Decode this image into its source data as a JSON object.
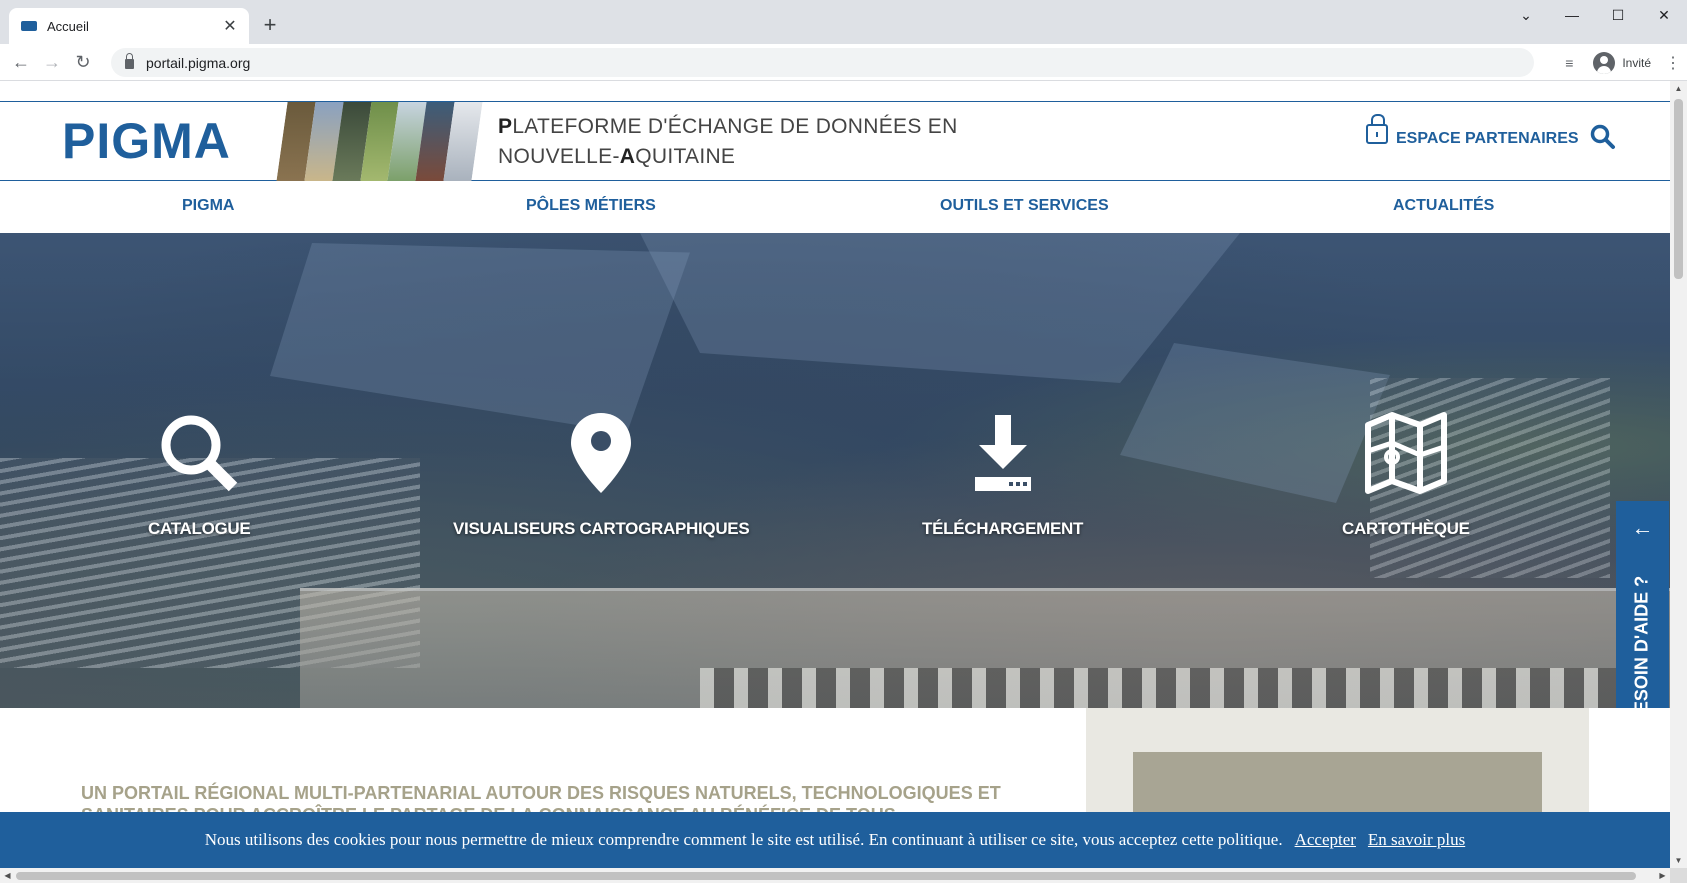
{
  "browser": {
    "tab_title": "Accueil",
    "url": "portail.pigma.org",
    "profile_label": "Invité"
  },
  "header": {
    "logo": "PIGMA",
    "tagline_line1_first": "P",
    "tagline_line1_rest": "LATEFORME D'ÉCHANGE DE DONNÉES EN",
    "tagline_line2_first": "NOUVELLE-",
    "tagline_line2_cap": "A",
    "tagline_line2_rest": "QUITAINE",
    "partners_label": "ESPACE PARTENAIRES",
    "accent_color": "#1f5f9c"
  },
  "nav": {
    "items": [
      {
        "label": "PIGMA"
      },
      {
        "label": "PÔLES MÉTIERS"
      },
      {
        "label": "OUTILS ET SERVICES"
      },
      {
        "label": "ACTUALITÉS"
      }
    ]
  },
  "hero": {
    "links": [
      {
        "label": "CATALOGUE",
        "icon": "magnifier-icon"
      },
      {
        "label": "VISUALISEURS CARTOGRAPHIQUES",
        "icon": "map-pin-icon"
      },
      {
        "label": "TÉLÉCHARGEMENT",
        "icon": "download-icon"
      },
      {
        "label": "CARTOTHÈQUE",
        "icon": "folded-map-icon"
      }
    ]
  },
  "help": {
    "label": "BESOIN D'AIDE ?"
  },
  "intro": {
    "text": "UN PORTAIL RÉGIONAL MULTI-PARTENARIAL AUTOUR DES RISQUES NATURELS, TECHNOLOGIQUES ET SANITAIRES POUR ACCROÎTRE LE PARTAGE DE LA CONNAISSANCE AU BÉNÉFICE DE TOUS"
  },
  "cookie": {
    "text": "Nous utilisons des cookies pour nous permettre de mieux comprendre comment le site est utilisé. En continuant à utiliser ce site, vous acceptez cette politique.",
    "accept_label": "Accepter",
    "more_label": "En savoir plus"
  }
}
